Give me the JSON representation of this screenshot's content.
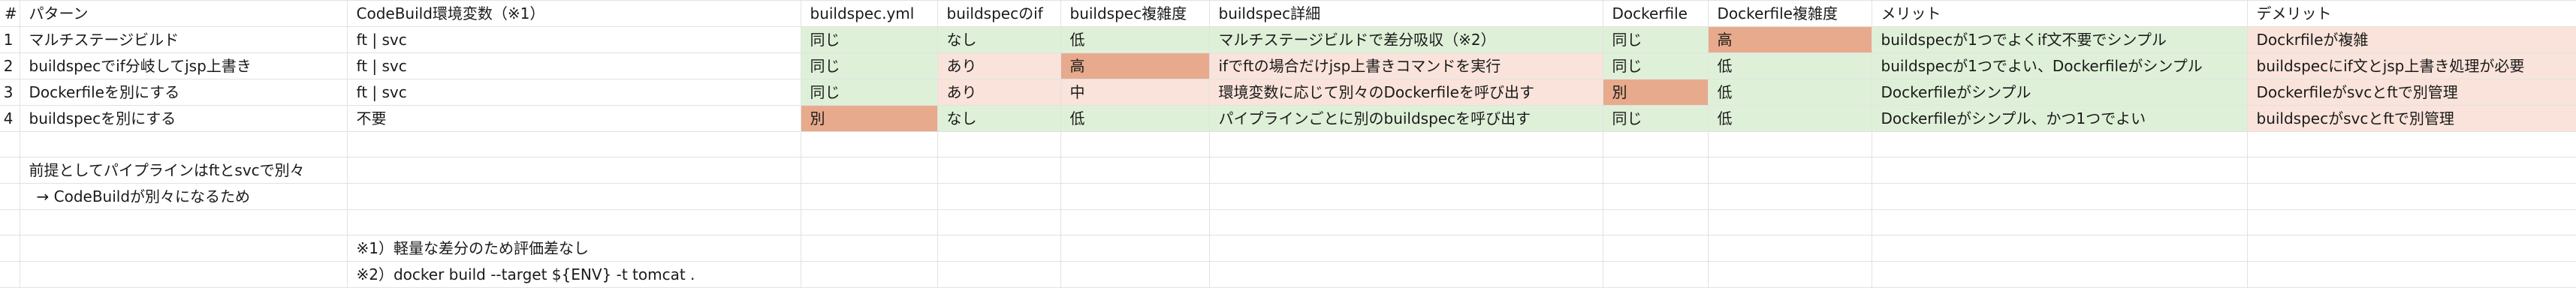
{
  "sheet": {
    "columns": [
      "#",
      "パターン",
      "CodeBuild環境変数（※1）",
      "buildspec.yml",
      "buildspecのif",
      "buildspec複雑度",
      "buildspec詳細",
      "Dockerfile",
      "Dockerfile複雑度",
      "メリット",
      "デメリット"
    ],
    "rows": [
      {
        "num": "1",
        "pattern": "マルチステージビルド",
        "env": "ft | svc",
        "yml": "同じ",
        "if": "なし",
        "complexity": "低",
        "detail": "マルチステージビルドで差分吸収（※2）",
        "dockerfile": "同じ",
        "docker_complexity": "高",
        "merit": "buildspecが1つでよくif文不要でシンプル",
        "demerit": "Dockrfileが複雑"
      },
      {
        "num": "2",
        "pattern": "buildspecでif分岐してjsp上書き",
        "env": "ft | svc",
        "yml": "同じ",
        "if": "あり",
        "complexity": "高",
        "detail": "ifでftの場合だけjsp上書きコマンドを実行",
        "dockerfile": "同じ",
        "docker_complexity": "低",
        "merit": "buildspecが1つでよい、Dockerfileがシンプル",
        "demerit": "buildspecにif文とjsp上書き処理が必要"
      },
      {
        "num": "3",
        "pattern": "Dockerfileを別にする",
        "env": "ft | svc",
        "yml": "同じ",
        "if": "あり",
        "complexity": "中",
        "detail": "環境変数に応じて別々のDockerfileを呼び出す",
        "dockerfile": "別",
        "docker_complexity": "低",
        "merit": "Dockerfileがシンプル",
        "demerit": "Dockerfileがsvcとftで別管理"
      },
      {
        "num": "4",
        "pattern": "buildspecを別にする",
        "env": "不要",
        "yml": "別",
        "if": "なし",
        "complexity": "低",
        "detail": "パイプラインごとに別のbuildspecを呼び出す",
        "dockerfile": "同じ",
        "docker_complexity": "低",
        "merit": "Dockerfileがシンプル、かつ1つでよい",
        "demerit": "buildspecがsvcとftで別管理"
      }
    ],
    "notes": {
      "premise": "前提としてパイプラインはftとsvcで別々",
      "premise_arrow": "→  CodeBuildが別々になるため",
      "note1": "※1）軽量な差分のため評価差なし",
      "note2": "※2）docker build --target ${ENV} -t tomcat ."
    },
    "colors": {
      "good": "#dff0d8",
      "mid": "#f9e3da",
      "bad": "#e8aa8c",
      "grid": "#e2e2e2"
    }
  }
}
